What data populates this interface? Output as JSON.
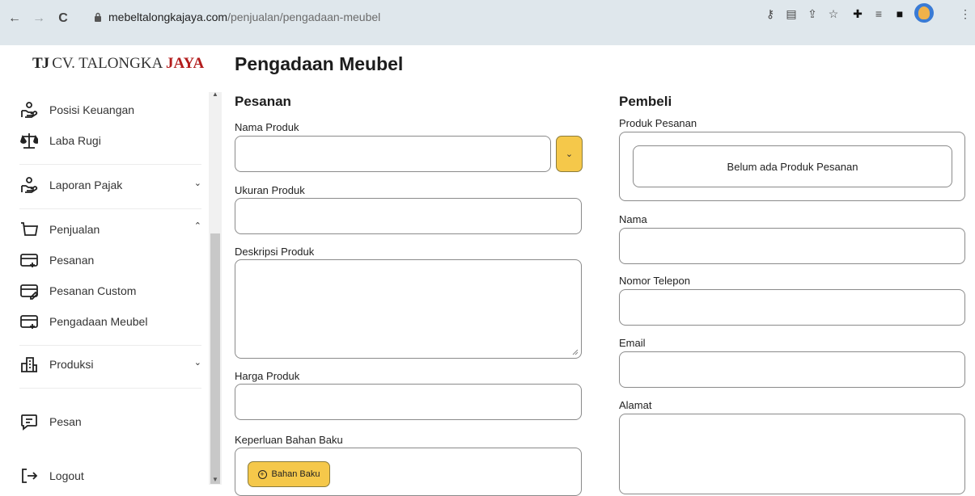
{
  "browser": {
    "url_domain": "mebeltalongkajaya.com",
    "url_path": "/penjualan/pengadaan-meubel"
  },
  "sidebar": {
    "logo_mark": "TJ",
    "logo_name": "CV. TALONGKA",
    "logo_accent": "JAYA",
    "items": [
      {
        "label": "Posisi Keuangan",
        "icon": "hand-coins-icon"
      },
      {
        "label": "Laba Rugi",
        "icon": "scale-icon"
      },
      {
        "label": "Laporan Pajak",
        "icon": "hand-coins-icon",
        "expandable": true
      },
      {
        "label": "Penjualan",
        "icon": "cart-icon",
        "expanded": true
      },
      {
        "label": "Pesanan",
        "icon": "card-add-icon"
      },
      {
        "label": "Pesanan Custom",
        "icon": "card-edit-icon"
      },
      {
        "label": "Pengadaan Meubel",
        "icon": "card-add-icon"
      },
      {
        "label": "Produksi",
        "icon": "factory-icon",
        "expandable": true
      },
      {
        "label": "Pesan",
        "icon": "message-icon"
      },
      {
        "label": "Logout",
        "icon": "logout-icon"
      }
    ]
  },
  "main": {
    "title": "Pengadaan Meubel",
    "pesanan": {
      "title": "Pesanan",
      "nama_produk_label": "Nama Produk",
      "ukuran_produk_label": "Ukuran Produk",
      "deskripsi_produk_label": "Deskripsi Produk",
      "harga_produk_label": "Harga Produk",
      "bahan_baku_label": "Keperluan Bahan Baku",
      "bahan_baku_button": "Bahan Baku"
    },
    "pembeli": {
      "title": "Pembeli",
      "produk_pesanan_label": "Produk Pesanan",
      "produk_pesanan_empty": "Belum ada Produk Pesanan",
      "nama_label": "Nama",
      "telepon_label": "Nomor Telepon",
      "email_label": "Email",
      "alamat_label": "Alamat"
    }
  },
  "colors": {
    "accent_yellow": "#f5c84a",
    "logo_red": "#b31d1d",
    "chrome_bg": "#dfe7ec"
  }
}
